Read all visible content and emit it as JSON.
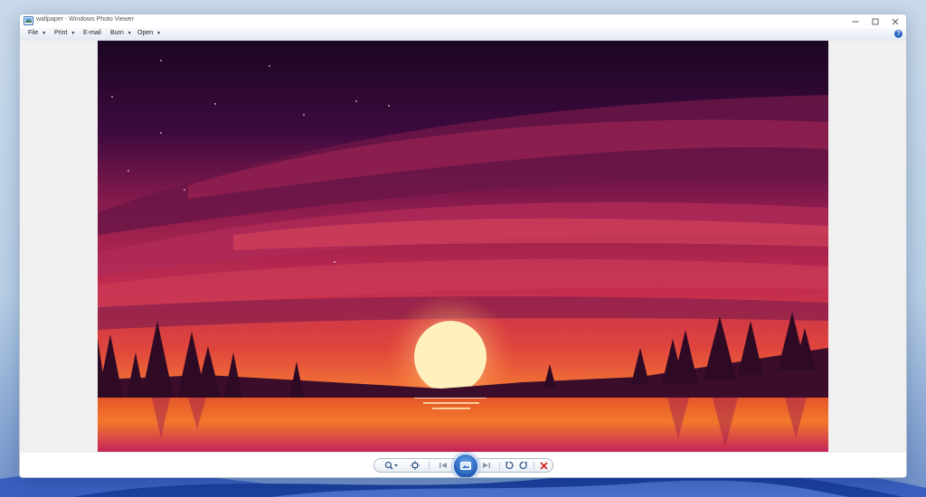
{
  "window": {
    "title": "wallpaper - Windows Photo Viewer"
  },
  "menu": {
    "items": [
      {
        "label": "File",
        "has_dropdown": true
      },
      {
        "label": "Print",
        "has_dropdown": true
      },
      {
        "label": "E-mail",
        "has_dropdown": false
      },
      {
        "label": "Burn",
        "has_dropdown": true
      },
      {
        "label": "Open",
        "has_dropdown": true
      }
    ],
    "help_label": "?"
  },
  "toolbar": {
    "buttons": [
      "zoom-icon",
      "actual-size-icon",
      "previous-icon",
      "slideshow-icon",
      "next-icon",
      "rotate-counterclockwise-icon",
      "rotate-clockwise-icon",
      "delete-icon"
    ]
  },
  "colors": {
    "accent": "#2a67c5",
    "delete": "#d21f1f"
  },
  "image": {
    "description_icon": "sunset-landscape"
  }
}
